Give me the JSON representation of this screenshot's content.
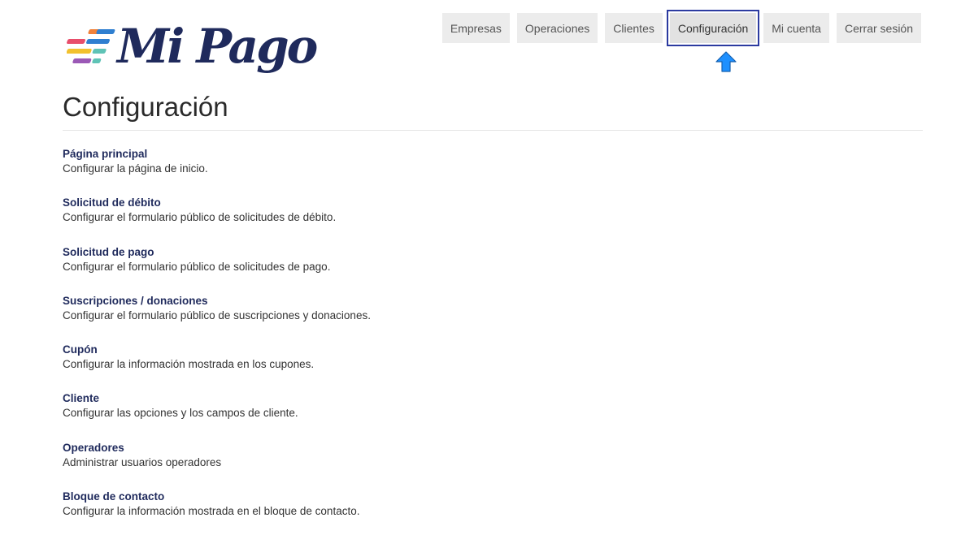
{
  "brand": {
    "name": "Mi Pago",
    "colors": {
      "text": "#1f2a5c",
      "stripes": [
        "#f0813a",
        "#2f7fd0",
        "#f2c12e",
        "#5fc3b6",
        "#9b59b6",
        "#e84e6b"
      ]
    }
  },
  "nav": {
    "items": [
      {
        "label": "Empresas",
        "active": false
      },
      {
        "label": "Operaciones",
        "active": false
      },
      {
        "label": "Clientes",
        "active": false
      },
      {
        "label": "Configuración",
        "active": true
      },
      {
        "label": "Mi cuenta",
        "active": false
      },
      {
        "label": "Cerrar sesión",
        "active": false
      }
    ]
  },
  "annotation": {
    "icon": "arrow-up-icon",
    "color": "#1e90ff"
  },
  "page": {
    "title": "Configuración"
  },
  "settings": [
    {
      "title": "Página principal",
      "description": "Configurar la página de inicio."
    },
    {
      "title": "Solicitud de débito",
      "description": "Configurar el formulario público de solicitudes de débito."
    },
    {
      "title": "Solicitud de pago",
      "description": "Configurar el formulario público de solicitudes de pago."
    },
    {
      "title": "Suscripciones / donaciones",
      "description": "Configurar el formulario público de suscripciones y donaciones."
    },
    {
      "title": "Cupón",
      "description": "Configurar la información mostrada en los cupones."
    },
    {
      "title": "Cliente",
      "description": "Configurar las opciones y los campos de cliente."
    },
    {
      "title": "Operadores",
      "description": "Administrar usuarios operadores"
    },
    {
      "title": "Bloque de contacto",
      "description": "Configurar la información mostrada en el bloque de contacto."
    }
  ]
}
